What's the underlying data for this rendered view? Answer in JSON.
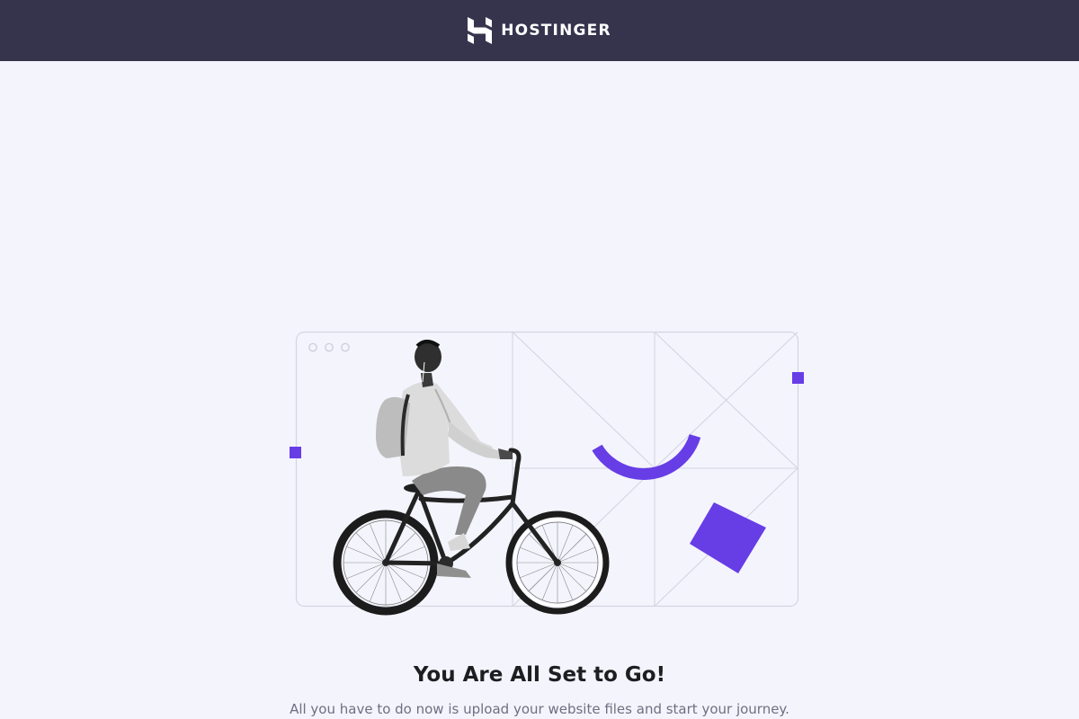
{
  "header": {
    "brand_name": "HOSTINGER",
    "logo_icon": "hostinger-h-logo-icon",
    "background_color": "#36344d"
  },
  "illustration": {
    "subject": "cyclist-photo",
    "window_icon": "browser-window-icon",
    "accent_color": "#673de6"
  },
  "hero": {
    "title": "You Are All Set to Go!",
    "subtitle": "All you have to do now is upload your website files and start your journey."
  },
  "colors": {
    "page_background": "#f4f4fd",
    "title_text": "#1d1e20",
    "subtitle_text": "#6d7081"
  }
}
